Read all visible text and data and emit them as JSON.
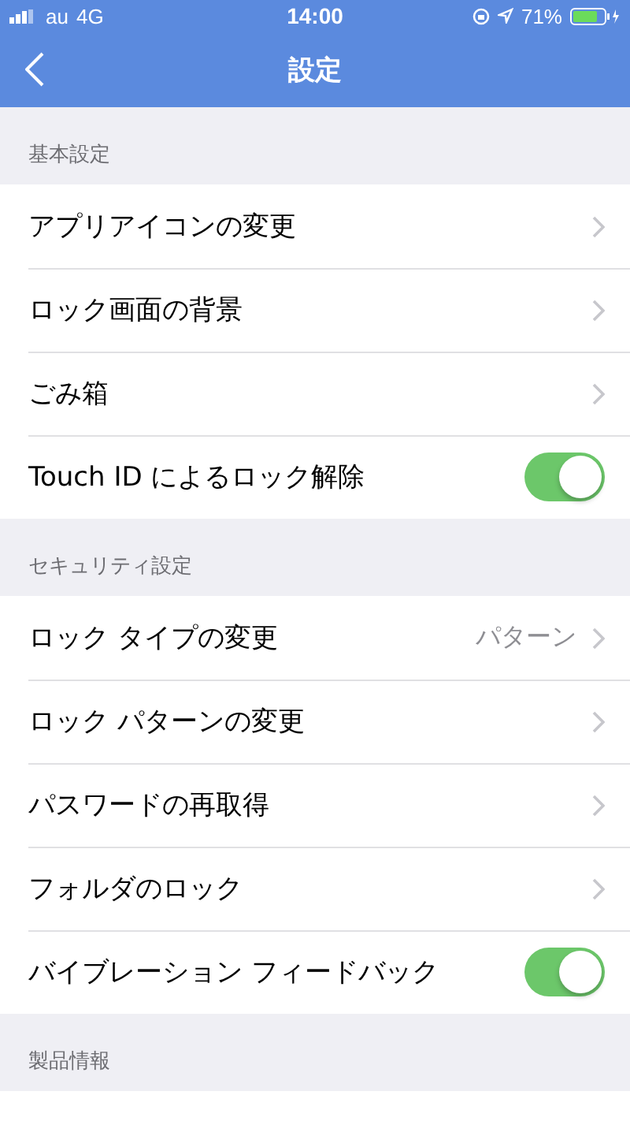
{
  "status_bar": {
    "carrier": "au",
    "network": "4G",
    "time": "14:00",
    "battery": "71%"
  },
  "nav_bar": {
    "title": "設定"
  },
  "sections": [
    {
      "header": "基本設定",
      "items": [
        {
          "kind": "link",
          "label": "アプリアイコンの変更"
        },
        {
          "kind": "link",
          "label": "ロック画面の背景"
        },
        {
          "kind": "link",
          "label": "ごみ箱"
        },
        {
          "kind": "toggle",
          "label": "Touch ID によるロック解除",
          "on": true
        }
      ]
    },
    {
      "header": "セキュリティ設定",
      "items": [
        {
          "kind": "link",
          "label": "ロック タイプの変更",
          "value": "パターン"
        },
        {
          "kind": "link",
          "label": "ロック パターンの変更"
        },
        {
          "kind": "link",
          "label": "パスワードの再取得"
        },
        {
          "kind": "link",
          "label": "フォルダのロック"
        },
        {
          "kind": "toggle",
          "label": "バイブレーション フィードバック",
          "on": true
        }
      ]
    },
    {
      "header": "製品情報"
    }
  ]
}
